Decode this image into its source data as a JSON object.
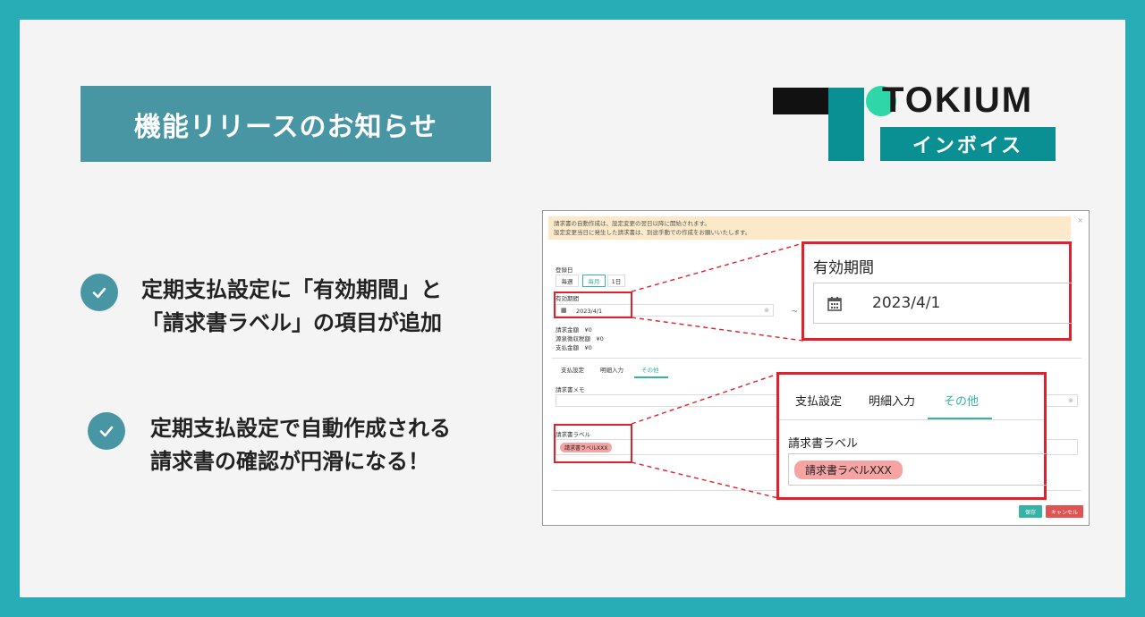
{
  "title": "機能リリースのお知らせ",
  "logo": {
    "word": "TOKIUM",
    "sub": "インボイス"
  },
  "bullets": [
    {
      "text": "定期支払設定に「有効期間」と\n「請求書ラベル」の項目が追加"
    },
    {
      "text": "定期支払設定で自動作成される\n請求書の確認が円滑になる！"
    }
  ],
  "screenshot": {
    "notice_line1": "請求書の自動作成は、設定変更の翌日以降に開始されます。",
    "notice_line2": "設定変更当日に発生した請求書は、別途手動での作成をお願いいたします。",
    "close": "×",
    "registration_label": "登録日",
    "freq_options": [
      "毎週",
      "毎月",
      "1日"
    ],
    "valid_label": "有効期間",
    "date_value": "2023/4/1",
    "tilde": "〜",
    "amounts": [
      "請求金額　¥0",
      "源泉徴収税額　¥0",
      "支払金額　¥0"
    ],
    "tabs": [
      "支払設定",
      "明細入力",
      "その他"
    ],
    "memo_label": "請求書メモ",
    "label_label": "請求書ラベル",
    "label_value": "請求書ラベルXXX",
    "save_btn": "保存",
    "cancel_btn": "キャンセル"
  },
  "zoom1": {
    "title": "有効期間",
    "date": "2023/4/1"
  },
  "zoom2": {
    "tabs": [
      "支払設定",
      "明細入力",
      "その他"
    ],
    "label": "請求書ラベル",
    "value": "請求書ラベルXXX"
  },
  "colors": {
    "frame": "#28adb7",
    "title_bg": "#4896a4",
    "accent": "#35b3a5",
    "highlight": "#e0202a",
    "logo_teal": "#0a8f92",
    "logo_dot": "#2ed6a8"
  }
}
